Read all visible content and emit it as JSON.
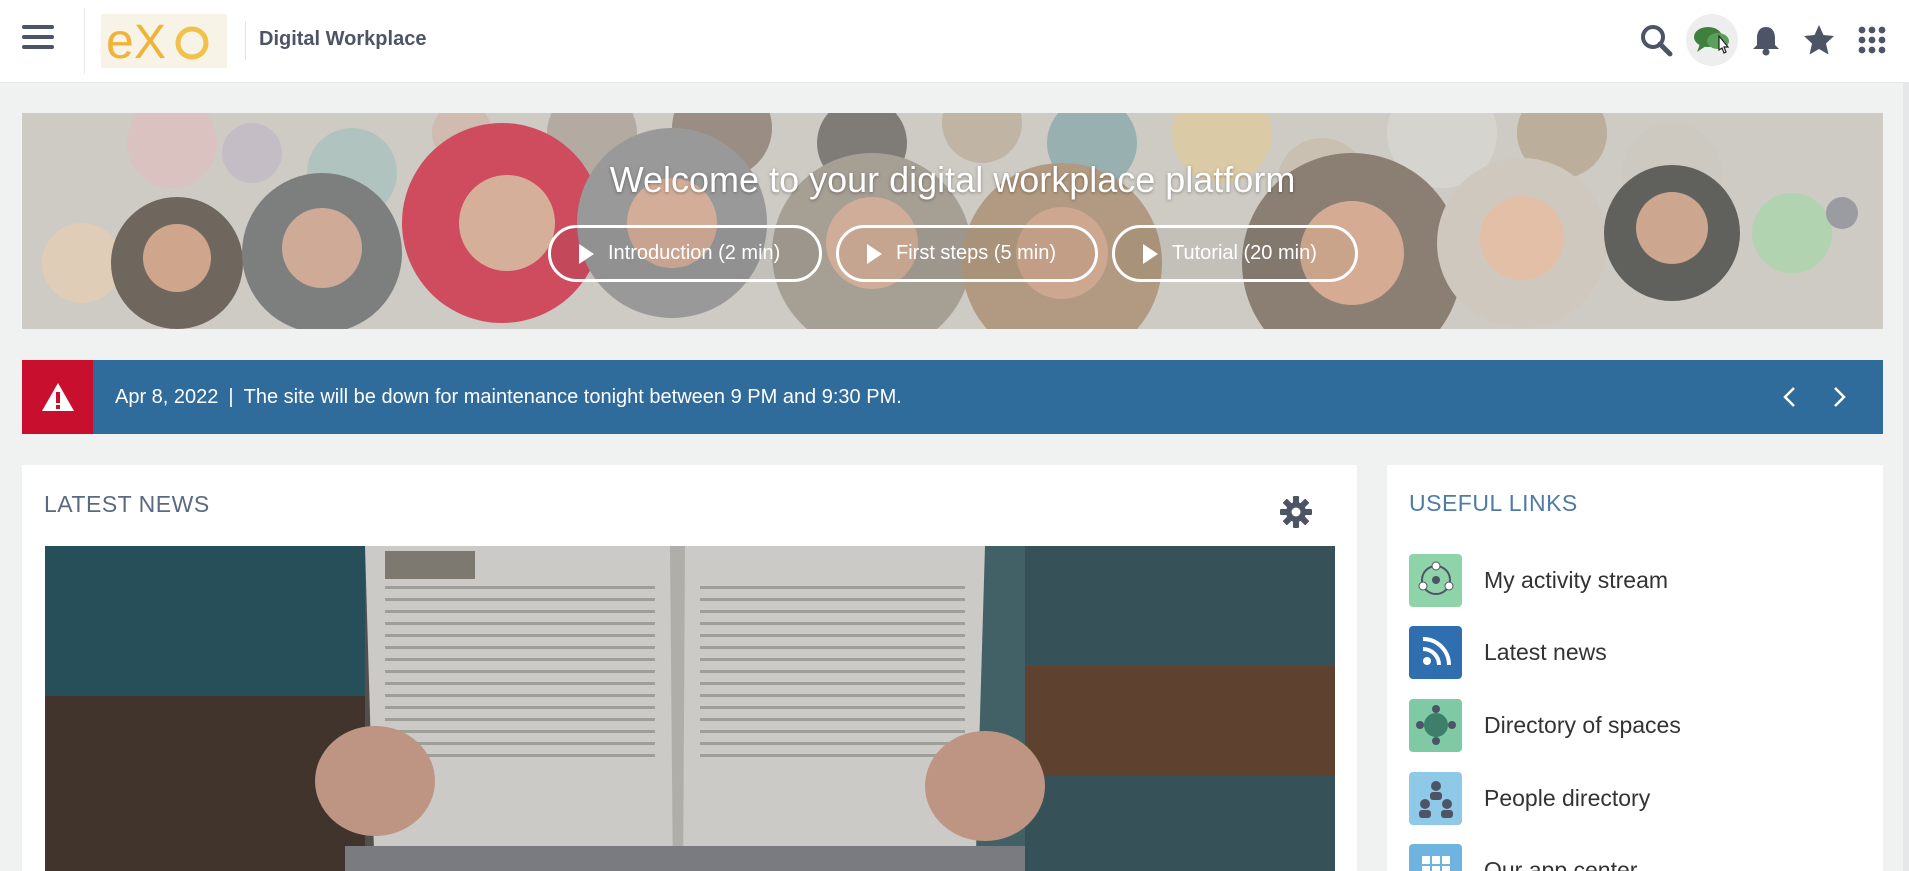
{
  "topbar": {
    "site_title": "Digital Workplace",
    "logo_text": "eXo",
    "icons": [
      "menu-icon",
      "search-icon",
      "chat-icon",
      "bell-icon",
      "star-icon",
      "apps-grid-icon"
    ]
  },
  "banner": {
    "title": "Welcome to your digital workplace platform",
    "buttons": [
      {
        "label": "Introduction (2 min)"
      },
      {
        "label": "First steps (5 min)"
      },
      {
        "label": "Tutorial (20 min)"
      }
    ]
  },
  "alert": {
    "date": "Apr 8, 2022",
    "separator": "|",
    "message": "The site will be down for maintenance tonight between 9 PM and 9:30 PM.",
    "color": "#2f6b9b",
    "icon_color": "#c8102e"
  },
  "news": {
    "title": "LATEST NEWS"
  },
  "useful_links": {
    "title": "USEFUL LINKS",
    "items": [
      {
        "label": "My activity stream",
        "icon": "activity-stream-icon",
        "color": "#8fd3a8"
      },
      {
        "label": "Latest news",
        "icon": "rss-icon",
        "color": "#2f6fb0"
      },
      {
        "label": "Directory of spaces",
        "icon": "spaces-icon",
        "color": "#7fc9a4"
      },
      {
        "label": "People directory",
        "icon": "people-icon",
        "color": "#8fc9e8"
      },
      {
        "label": "Our app center",
        "icon": "app-center-icon",
        "color": "#6fb3e0"
      }
    ]
  }
}
